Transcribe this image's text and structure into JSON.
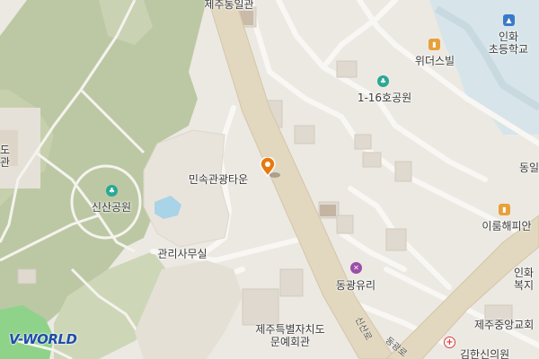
{
  "map": {
    "labels": {
      "jeju_unification_hall": "제주통일관",
      "inhwa_elementary": "인화\n초등학교",
      "widers_villa": "위더스빌",
      "park_1_16": "1-16호공원",
      "left_edge_label": "도\n관",
      "folk_tourism_town": "민속관광타운",
      "sinsan_park": "신산공원",
      "dong_edge": "동일",
      "irum_haepian": "이룸해피안",
      "management_office": "관리사무실",
      "donggwang_glass": "동광유리",
      "inhwa_welfare": "인화\n복지",
      "jeju_culture_hall": "제주특별자치도\n문예회관",
      "jeju_central_church": "제주중앙교회",
      "kim_hospital": "김한신의원",
      "sinsan_ro": "신산로",
      "donggwang_ro": "동광로"
    },
    "icons": {
      "apartment": "apartment-icon",
      "school": "school-icon",
      "park": "park-icon",
      "shop": "tools-icon",
      "hospital": "hospital-icon",
      "location_pin": "location-pin-icon"
    },
    "colors": {
      "background": "#ece9e3",
      "park_green": "#bcc8a4",
      "park_green_light": "#cdd7b8",
      "road_major": "#e2d7bf",
      "road_minor": "#f8f7f4",
      "water": "#a9d3e6",
      "river": "#8fd28a",
      "pin": "#e8780f",
      "logo": "#1f4ea8"
    }
  },
  "logo": {
    "text": "V-WORLD"
  }
}
